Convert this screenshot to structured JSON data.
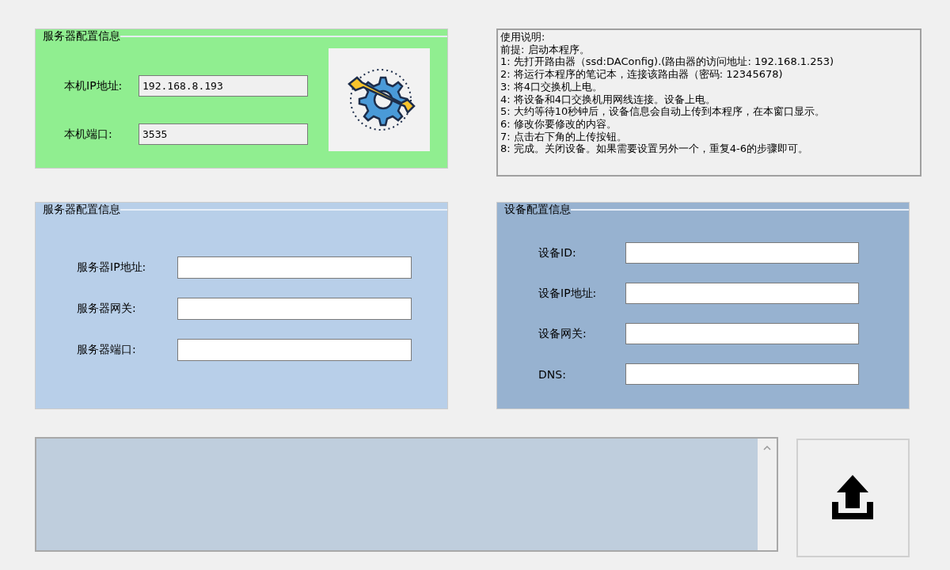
{
  "local_panel": {
    "title": "服务器配置信息",
    "fields": [
      {
        "label": "本机IP地址:",
        "value": "192.168.8.193"
      },
      {
        "label": "本机端口:",
        "value": "3535"
      }
    ]
  },
  "instructions": {
    "lines": [
      "使用说明:",
      "前提: 启动本程序。",
      "1: 先打开路由器（ssd:DAConfig).(路由器的访问地址: 192.168.1.253)",
      "2: 将运行本程序的笔记本，连接该路由器（密码: 12345678)",
      "3: 将4口交换机上电。",
      "4: 将设备和4口交换机用网线连接。设备上电。",
      "5: 大约等待10秒钟后，设备信息会自动上传到本程序，在本窗口显示。",
      "6: 修改你要修改的内容。",
      "7: 点击右下角的上传按钮。",
      "8: 完成。关闭设备。如果需要设置另外一个，重复4-6的步骤即可。"
    ]
  },
  "server_panel": {
    "title": "服务器配置信息",
    "fields": [
      {
        "label": "服务器IP地址:"
      },
      {
        "label": "服务器网关:"
      },
      {
        "label": "服务器端口:"
      }
    ]
  },
  "device_panel": {
    "title": "设备配置信息",
    "fields": [
      {
        "label": "设备ID:"
      },
      {
        "label": "设备IP地址:"
      },
      {
        "label": "设备网关:"
      },
      {
        "label": "DNS:"
      }
    ]
  }
}
